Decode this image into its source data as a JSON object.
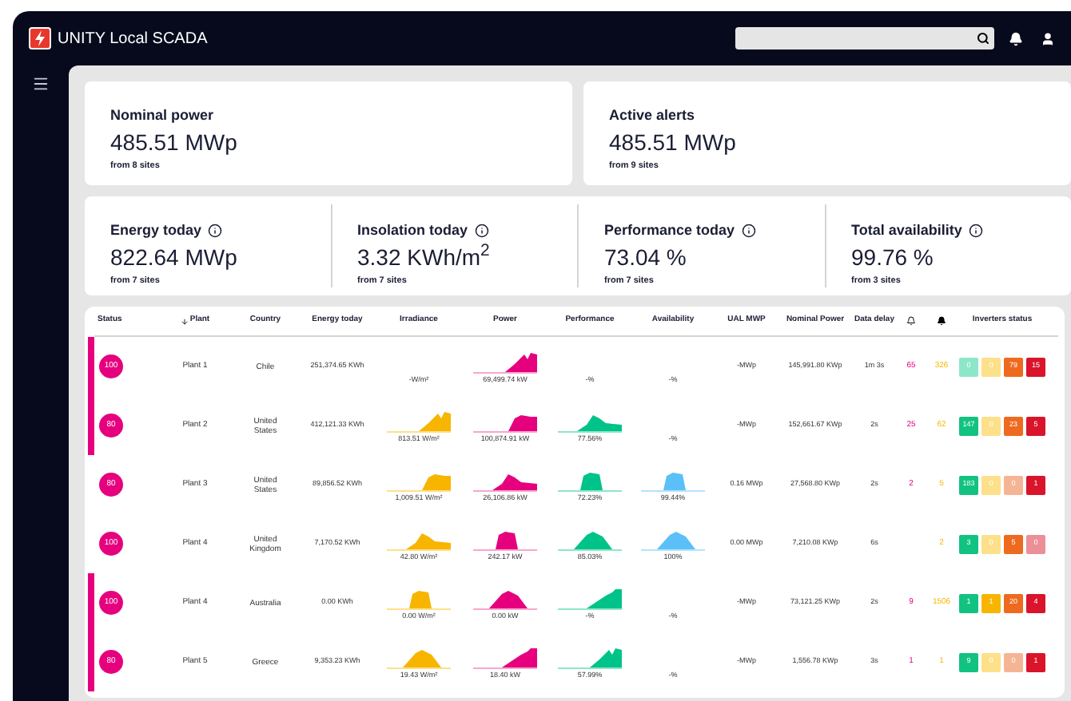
{
  "app": {
    "title": "UNITY Local SCADA"
  },
  "summary_cards": [
    {
      "label": "Nominal power",
      "value": "485.51 MWp",
      "note": "from 8 sites",
      "info": false
    },
    {
      "label": "Active alerts",
      "value": "485.51 MWp",
      "note": "from 9 sites",
      "info": false
    }
  ],
  "kpi_cards": [
    {
      "label": "Energy today",
      "value": "822.64 MWp",
      "note": "from 7 sites",
      "info": true
    },
    {
      "label": "Insolation today",
      "value": "3.32 KWh/m$^{2}$",
      "note": "from 7 sites",
      "info": true
    },
    {
      "label": "Performance today",
      "value": "73.04 %",
      "note": "from 7 sites",
      "info": true
    },
    {
      "label": "Total availability",
      "value": "99.76 %",
      "note": "from 3 sites",
      "info": true
    }
  ],
  "table": {
    "columns": [
      {
        "kind": "text",
        "label": "Status",
        "sorted": false
      },
      {
        "kind": "text",
        "label": "Plant",
        "sorted": true
      },
      {
        "kind": "text",
        "label": "Country",
        "sorted": false
      },
      {
        "kind": "text",
        "label": "Energy today",
        "sorted": false
      },
      {
        "kind": "text",
        "label": "Irradiance",
        "sorted": false
      },
      {
        "kind": "text",
        "label": "Power",
        "sorted": false
      },
      {
        "kind": "text",
        "label": "Performance",
        "sorted": false
      },
      {
        "kind": "text",
        "label": "Availability",
        "sorted": false
      },
      {
        "kind": "text",
        "label": "UAL MWP",
        "sorted": false
      },
      {
        "kind": "text",
        "label": "Nominal Power",
        "sorted": false
      },
      {
        "kind": "text",
        "label": "Data delay",
        "sorted": false
      },
      {
        "kind": "alerts"
      },
      {
        "kind": "alarms"
      },
      {
        "kind": "text",
        "label": "Inverters status",
        "sorted": false
      }
    ],
    "rows": [
      {
        "alarm": true,
        "status": "100",
        "plant": "Plant 1",
        "country": "Chile",
        "energy": "251,374.65 KWh",
        "irradiance": {
          "chart": false,
          "reading": "-W/m²"
        },
        "power": {
          "chart": true,
          "reading": "69,499.74 kW"
        },
        "performance": {
          "chart": false,
          "reading": "-%"
        },
        "availability": {
          "chart": false,
          "reading": "-%"
        },
        "ual": "-MWp",
        "nominal": "145,991.80 KWp",
        "delay": "1m 3s",
        "alerts": "65",
        "alarms": "326",
        "inverters": [
          {
            "count": "0",
            "color": "#8ee6c9"
          },
          {
            "count": "0",
            "color": "#fde08a"
          },
          {
            "count": "79",
            "color": "#ee6a1f"
          },
          {
            "count": "15",
            "color": "#d9142b"
          }
        ]
      },
      {
        "alarm": true,
        "status": "80",
        "plant": "Plant 2",
        "country": "United States",
        "energy": "412,121.33 KWh",
        "irradiance": {
          "chart": true,
          "reading": "813.51 W/m²"
        },
        "power": {
          "chart": true,
          "reading": "100,874.91 kW"
        },
        "performance": {
          "chart": true,
          "reading": "77.56%"
        },
        "availability": {
          "chart": false,
          "reading": "-%"
        },
        "ual": "-MWp",
        "nominal": "152,661.67 KWp",
        "delay": "2s",
        "alerts": "25",
        "alarms": "62",
        "inverters": [
          {
            "count": "147",
            "color": "#12c281"
          },
          {
            "count": "0",
            "color": "#fde08a"
          },
          {
            "count": "23",
            "color": "#ee6a1f"
          },
          {
            "count": "5",
            "color": "#d9142b"
          }
        ]
      },
      {
        "alarm": false,
        "status": "80",
        "plant": "Plant 3",
        "country": "United States",
        "energy": "89,856.52 KWh",
        "irradiance": {
          "chart": true,
          "reading": "1,009.51 W/m²"
        },
        "power": {
          "chart": true,
          "reading": "26,106.86 kW"
        },
        "performance": {
          "chart": true,
          "reading": "72.23%"
        },
        "availability": {
          "chart": true,
          "reading": "99.44%"
        },
        "ual": "0.16 MWp",
        "nominal": "27,568.80 KWp",
        "delay": "2s",
        "alerts": "2",
        "alarms": "5",
        "inverters": [
          {
            "count": "183",
            "color": "#12c281"
          },
          {
            "count": "0",
            "color": "#fde08a"
          },
          {
            "count": "0",
            "color": "#f5b595"
          },
          {
            "count": "1",
            "color": "#d9142b"
          }
        ]
      },
      {
        "alarm": false,
        "status": "100",
        "plant": "Plant 4",
        "country": "United Kingdom",
        "energy": "7,170.52 KWh",
        "irradiance": {
          "chart": true,
          "reading": "42.80 W/m²"
        },
        "power": {
          "chart": true,
          "reading": "242.17 kW"
        },
        "performance": {
          "chart": true,
          "reading": "85.03%"
        },
        "availability": {
          "chart": true,
          "reading": "100%"
        },
        "ual": "0.00 MWp",
        "nominal": "7,210.08 KWp",
        "delay": "6s",
        "alarms": "2",
        "inverters": [
          {
            "count": "3",
            "color": "#12c281"
          },
          {
            "count": "0",
            "color": "#fde08a"
          },
          {
            "count": "5",
            "color": "#ee6a1f"
          },
          {
            "count": "0",
            "color": "#ec8f98"
          }
        ]
      },
      {
        "alarm": true,
        "status": "100",
        "plant": "Plant 4",
        "country": "Australia",
        "energy": "0.00 KWh",
        "irradiance": {
          "chart": true,
          "reading": "0.00 W/m²"
        },
        "power": {
          "chart": true,
          "reading": "0.00 kW"
        },
        "performance": {
          "chart": true,
          "reading": "-%"
        },
        "availability": {
          "chart": false,
          "reading": "-%"
        },
        "ual": "-MWp",
        "nominal": "73,121.25 KWp",
        "delay": "2s",
        "alerts": "9",
        "alarms": "1506",
        "inverters": [
          {
            "count": "1",
            "color": "#12c281"
          },
          {
            "count": "1",
            "color": "#f7b500"
          },
          {
            "count": "20",
            "color": "#ee6a1f"
          },
          {
            "count": "4",
            "color": "#d9142b"
          }
        ]
      },
      {
        "alarm": true,
        "status": "80",
        "plant": "Plant 5",
        "country": "Greece",
        "energy": "9,353.23 KWh",
        "irradiance": {
          "chart": true,
          "reading": "19.43 W/m²"
        },
        "power": {
          "chart": true,
          "reading": "18.40 kW"
        },
        "performance": {
          "chart": true,
          "reading": "57.99%"
        },
        "availability": {
          "chart": false,
          "reading": "-%"
        },
        "ual": "-MWp",
        "nominal": "1,556.78 KWp",
        "delay": "3s",
        "alerts": "1",
        "alarms": "1",
        "inverters": [
          {
            "count": "9",
            "color": "#12c281"
          },
          {
            "count": "0",
            "color": "#fde08a"
          },
          {
            "count": "0",
            "color": "#f5b595"
          },
          {
            "count": "1",
            "color": "#d9142b"
          }
        ]
      }
    ]
  }
}
